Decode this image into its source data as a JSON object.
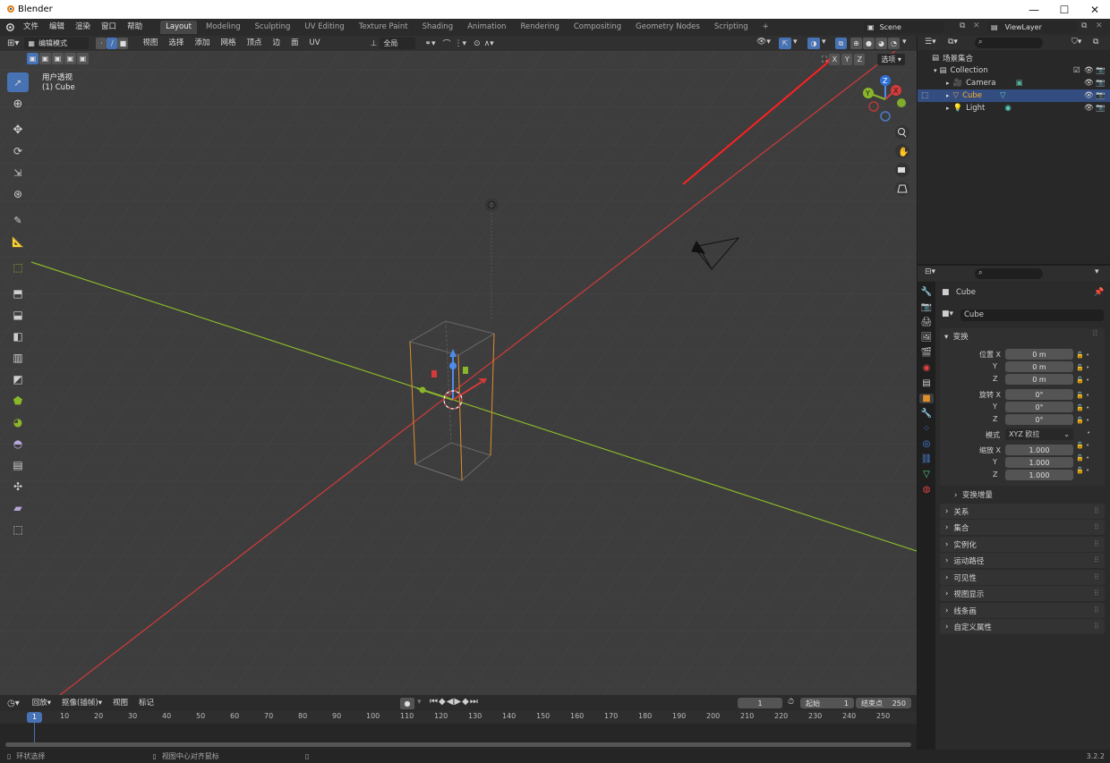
{
  "window": {
    "title": "Blender",
    "minimize": "—",
    "maximize": "☐",
    "close": "✕"
  },
  "menus": [
    "文件",
    "编辑",
    "渲染",
    "窗口",
    "帮助"
  ],
  "workspaces": [
    "Layout",
    "Modeling",
    "Sculpting",
    "UV Editing",
    "Texture Paint",
    "Shading",
    "Animation",
    "Rendering",
    "Compositing",
    "Geometry Nodes",
    "Scripting"
  ],
  "active_workspace": "Layout",
  "add_workspace": "+",
  "scene": {
    "name": "Scene",
    "view_layer": "ViewLayer"
  },
  "viewport_header": {
    "mode": "编辑模式",
    "menus": [
      "视图",
      "选择",
      "添加",
      "网格",
      "顶点",
      "边",
      "面",
      "UV"
    ],
    "transform_orientation": "全局",
    "axes": [
      "X",
      "Y",
      "Z"
    ],
    "options": "选项"
  },
  "viewport": {
    "view_name": "用户透视",
    "object_label": "(1) Cube"
  },
  "outliner": {
    "root": "场景集合",
    "collection": "Collection",
    "items": [
      {
        "name": "Camera",
        "selected": false
      },
      {
        "name": "Cube",
        "selected": true
      },
      {
        "name": "Light",
        "selected": false
      }
    ]
  },
  "properties": {
    "object_name": "Cube",
    "data_name": "Cube",
    "section_transform": "变换",
    "location_label": "位置 X",
    "rotation_label": "旋转 X",
    "scale_label": "缩放 X",
    "axis_y": "Y",
    "axis_z": "Z",
    "location": [
      "0 m",
      "0 m",
      "0 m"
    ],
    "rotation": [
      "0°",
      "0°",
      "0°"
    ],
    "mode_label": "模式",
    "rotation_mode": "XYZ 欧拉",
    "scale": [
      "1.000",
      "1.000",
      "1.000"
    ],
    "delta_transform": "变换增量",
    "panels": [
      "关系",
      "集合",
      "实例化",
      "运动路径",
      "可见性",
      "视图显示",
      "线条画",
      "自定义属性"
    ]
  },
  "timeline": {
    "playback": "回放",
    "keying": "抠像(插帧)",
    "view": "视图",
    "marker": "标记",
    "current_frame": "1",
    "start_label": "起始",
    "start": "1",
    "end_label": "结束点",
    "end": "250",
    "ruler": [
      "10",
      "20",
      "30",
      "40",
      "50",
      "60",
      "70",
      "80",
      "90",
      "100",
      "110",
      "120",
      "130",
      "140",
      "150",
      "160",
      "170",
      "180",
      "190",
      "200",
      "210",
      "220",
      "230",
      "240",
      "250"
    ],
    "playhead_label": "1"
  },
  "status": {
    "left": "环状选择",
    "middle": "视图中心对齐鼠标",
    "version": "3.2.2"
  },
  "colors": {
    "accent": "#4772b3",
    "x_axis": "#d43a3a",
    "y_axis": "#8ab62a",
    "selection": "#e08d2c",
    "annotation_arrow": "#ff2020"
  }
}
